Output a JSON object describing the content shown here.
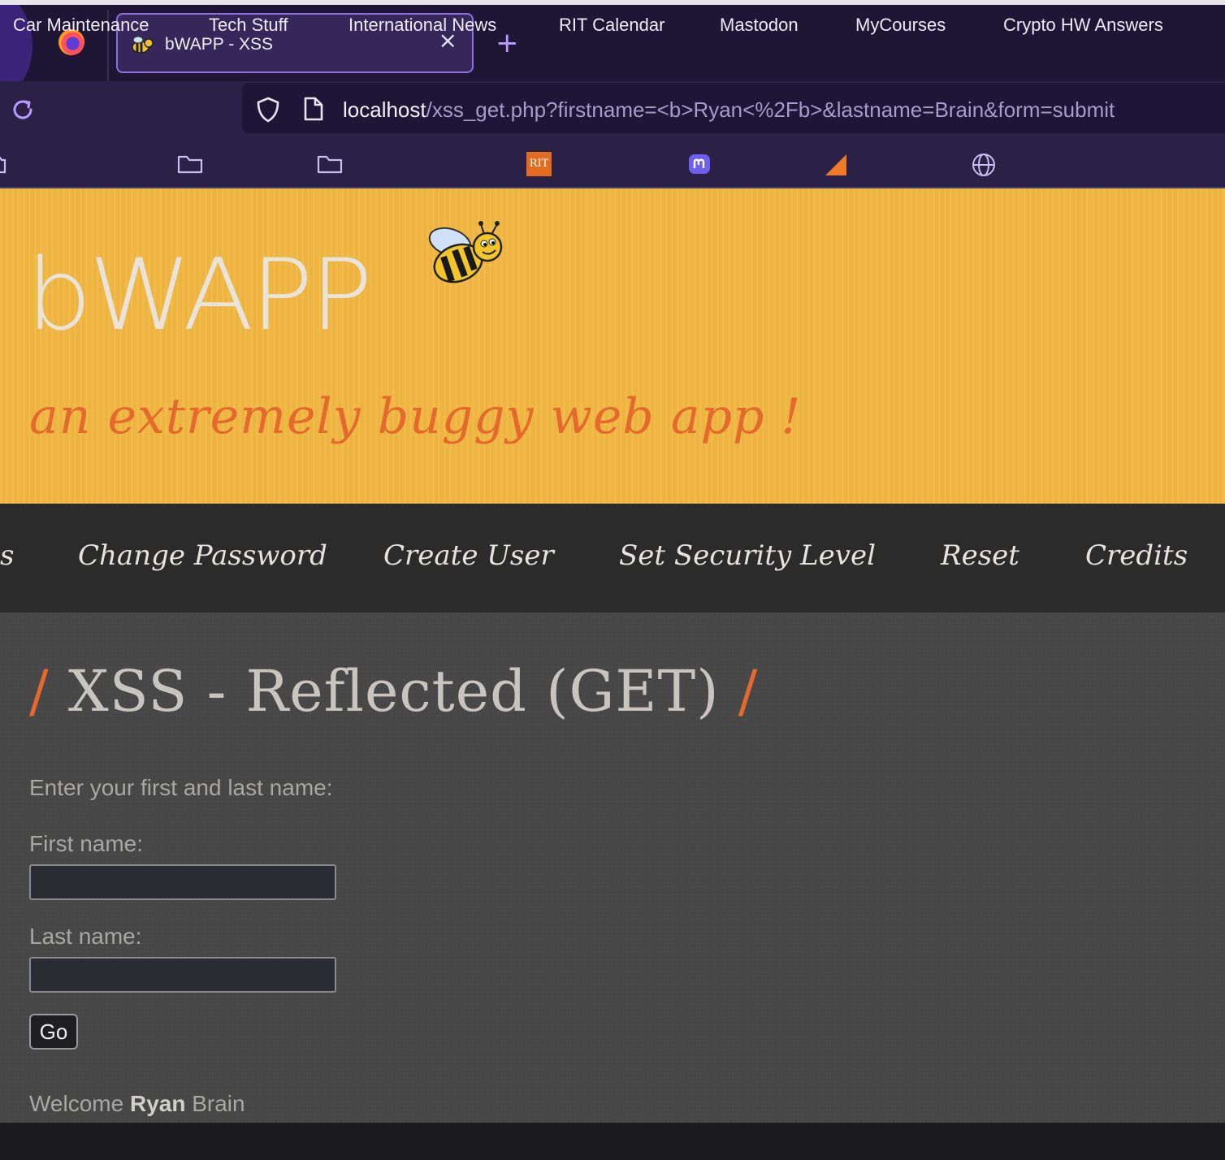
{
  "browser": {
    "tab_title": "bWAPP - XSS",
    "tab_close": "×",
    "new_tab": "+",
    "url_host": "localhost",
    "url_path": "/xss_get.php?firstname=<b>Ryan<%2Fb>&lastname=Brain&form=submit"
  },
  "bookmarks": [
    {
      "label": "Car Maintenance",
      "icon": "folder-icon"
    },
    {
      "label": "Tech Stuff",
      "icon": "folder-icon"
    },
    {
      "label": "International News",
      "icon": "folder-icon"
    },
    {
      "label": "RIT Calendar",
      "icon": "rit-icon",
      "icon_text": "RIT"
    },
    {
      "label": "Mastodon",
      "icon": "mastodon-icon"
    },
    {
      "label": "MyCourses",
      "icon": "mycourses-icon"
    },
    {
      "label": "Crypto HW Answers",
      "icon": "globe-icon"
    }
  ],
  "header": {
    "logo": "bWAPP",
    "tagline": "an extremely buggy web app !"
  },
  "menu": {
    "partial": "s",
    "items": [
      "Change Password",
      "Create User",
      "Set Security Level",
      "Reset",
      "Credits"
    ]
  },
  "content": {
    "title_slash": "/",
    "title": "XSS - Reflected (GET)",
    "intro": "Enter your first and last name:",
    "first_label": "First name:",
    "first_value": "",
    "last_label": "Last name:",
    "last_value": "",
    "go": "Go",
    "welcome_prefix": "Welcome",
    "welcome_first": "Ryan",
    "welcome_last": "Brain"
  },
  "colors": {
    "tab_bar": "#1f1535",
    "header_bg": "#f2b843",
    "accent_orange": "#e4692c",
    "menu_bg": "#2b2b2b",
    "content_bg": "#474747"
  }
}
